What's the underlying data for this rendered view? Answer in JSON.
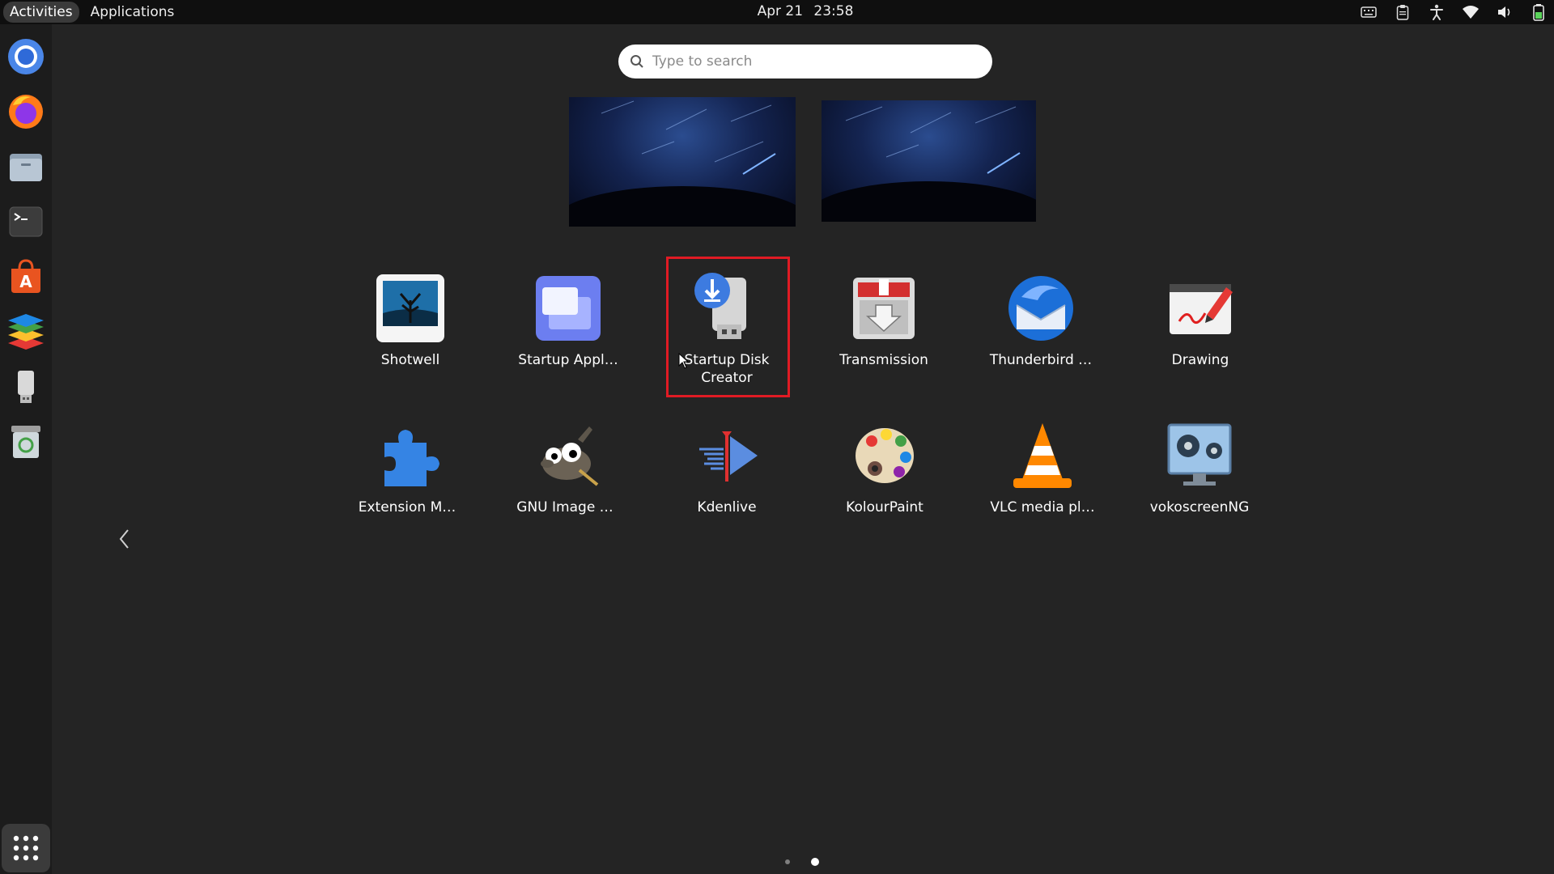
{
  "topbar": {
    "activities": "Activities",
    "applications": "Applications",
    "date": "Apr 21",
    "time": "23:58",
    "tray_icons": [
      "keyboard-icon",
      "clipboard-icon",
      "accessibility-icon",
      "wifi-icon",
      "volume-icon",
      "battery-icon"
    ]
  },
  "dock": {
    "items": [
      {
        "name": "chromium",
        "icon": "chromium-icon"
      },
      {
        "name": "firefox",
        "icon": "firefox-icon"
      },
      {
        "name": "files",
        "icon": "files-icon"
      },
      {
        "name": "terminal",
        "icon": "terminal-icon"
      },
      {
        "name": "app-center",
        "icon": "app-center-icon"
      },
      {
        "name": "layers",
        "icon": "layers-icon"
      },
      {
        "name": "usb-drive",
        "icon": "usb-drive-icon"
      },
      {
        "name": "trash",
        "icon": "trash-icon"
      }
    ],
    "show_apps_icon": "grid-icon"
  },
  "search": {
    "placeholder": "Type to search",
    "value": ""
  },
  "apps": {
    "row1": [
      {
        "label": "Shotwell",
        "icon": "shotwell-icon"
      },
      {
        "label": "Startup Appl…",
        "icon": "startup-applications-icon"
      },
      {
        "label": "Startup Disk Creator",
        "icon": "startup-disk-creator-icon",
        "highlighted": true
      },
      {
        "label": "Transmission",
        "icon": "transmission-icon"
      },
      {
        "label": "Thunderbird …",
        "icon": "thunderbird-icon"
      },
      {
        "label": "Drawing",
        "icon": "drawing-icon"
      }
    ],
    "row2": [
      {
        "label": "Extension M…",
        "icon": "extension-manager-icon"
      },
      {
        "label": "GNU Image …",
        "icon": "gimp-icon"
      },
      {
        "label": "Kdenlive",
        "icon": "kdenlive-icon"
      },
      {
        "label": "KolourPaint",
        "icon": "kolourpaint-icon"
      },
      {
        "label": "VLC media pl…",
        "icon": "vlc-icon"
      },
      {
        "label": "vokoscreenNG",
        "icon": "vokoscreen-icon"
      }
    ]
  },
  "pager": {
    "pages": 2,
    "current": 2
  },
  "colors": {
    "highlight": "#e01b24",
    "background": "#242424",
    "topbar": "#0f0f0f"
  }
}
